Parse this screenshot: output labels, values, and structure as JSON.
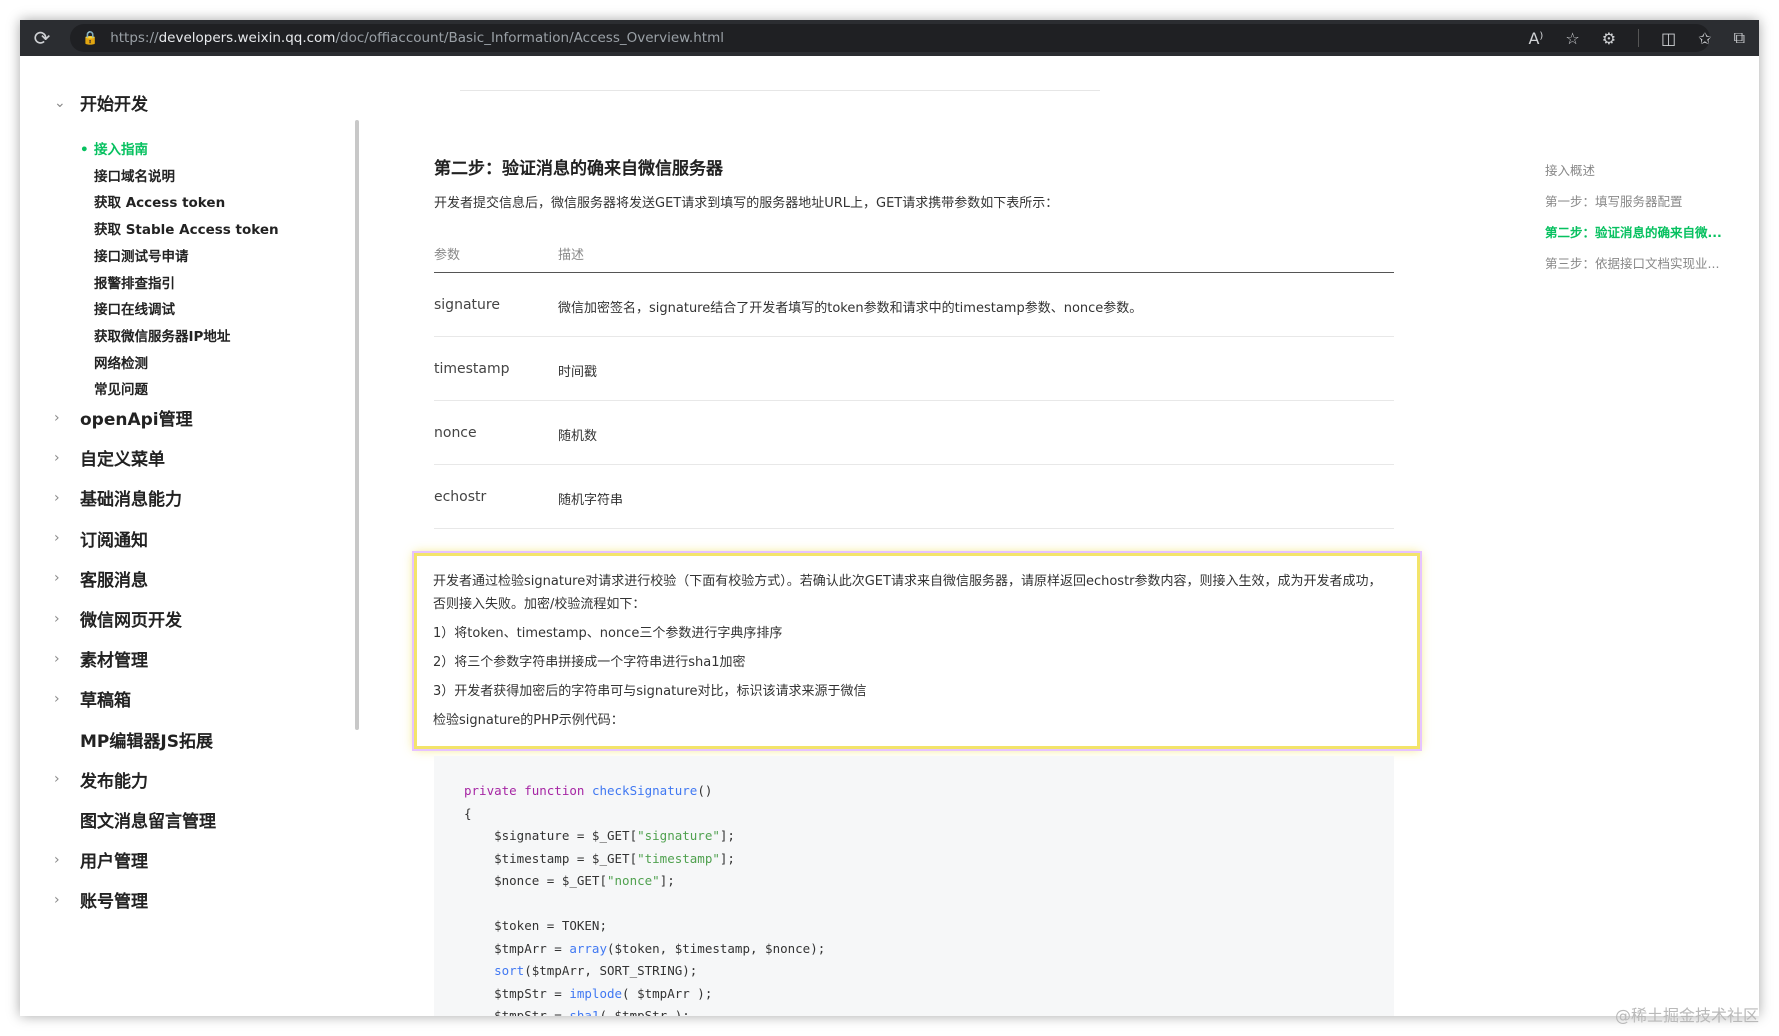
{
  "browser": {
    "url_prefix": "https://",
    "url_host": "developers.weixin.qq.com",
    "url_path": "/doc/offiaccount/Basic_Information/Access_Overview.html"
  },
  "sidebar": {
    "section_open": "开始开发",
    "sub_items": [
      {
        "label": "接入指南",
        "active": true
      },
      {
        "label": "接口域名说明"
      },
      {
        "label": "获取 Access token"
      },
      {
        "label": "获取 Stable Access token"
      },
      {
        "label": "接口测试号申请"
      },
      {
        "label": "报警排查指引"
      },
      {
        "label": "接口在线调试"
      },
      {
        "label": "获取微信服务器IP地址"
      },
      {
        "label": "网络检测"
      },
      {
        "label": "常见问题"
      }
    ],
    "sections": [
      {
        "label": "openApi管理"
      },
      {
        "label": "自定义菜单"
      },
      {
        "label": "基础消息能力"
      },
      {
        "label": "订阅通知"
      },
      {
        "label": "客服消息"
      },
      {
        "label": "微信网页开发"
      },
      {
        "label": "素材管理"
      },
      {
        "label": "草稿箱"
      },
      {
        "label": "MP编辑器JS拓展"
      },
      {
        "label": "发布能力"
      },
      {
        "label": "图文消息留言管理"
      },
      {
        "label": "用户管理"
      },
      {
        "label": "账号管理"
      }
    ]
  },
  "main": {
    "heading": "第二步：验证消息的确来自微信服务器",
    "intro": "开发者提交信息后，微信服务器将发送GET请求到填写的服务器地址URL上，GET请求携带参数如下表所示：",
    "table": {
      "headers": [
        "参数",
        "描述"
      ],
      "rows": [
        {
          "name": "signature",
          "desc": "微信加密签名，signature结合了开发者填写的token参数和请求中的timestamp参数、nonce参数。"
        },
        {
          "name": "timestamp",
          "desc": "时间戳"
        },
        {
          "name": "nonce",
          "desc": "随机数"
        },
        {
          "name": "echostr",
          "desc": "随机字符串"
        }
      ]
    },
    "highlight": {
      "p1": "开发者通过检验signature对请求进行校验（下面有校验方式）。若确认此次GET请求来自微信服务器，请原样返回echostr参数内容，则接入生效，成为开发者成功，否则接入失败。加密/校验流程如下：",
      "p2": "1）将token、timestamp、nonce三个参数进行字典序排序",
      "p3": "2）将三个参数字符串拼接成一个字符串进行sha1加密",
      "p4": "3）开发者获得加密后的字符串可与signature对比，标识该请求来源于微信",
      "p5": "检验signature的PHP示例代码："
    }
  },
  "toc": {
    "items": [
      {
        "label": "接入概述"
      },
      {
        "label": "第一步：填写服务器配置"
      },
      {
        "label": "第二步：验证消息的确来自微...",
        "active": true
      },
      {
        "label": "第三步：依据接口文档实现业..."
      }
    ]
  },
  "watermark": "@稀土掘金技术社区"
}
